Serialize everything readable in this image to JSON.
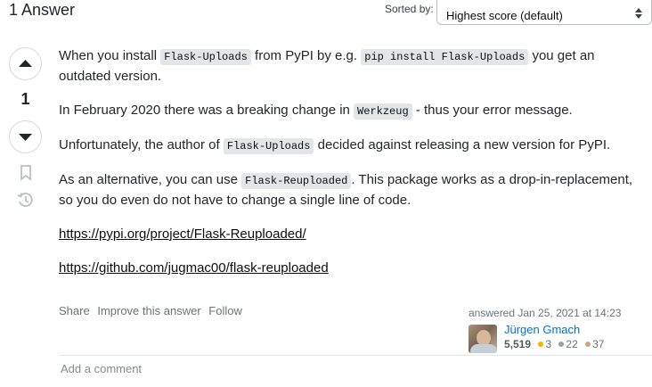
{
  "header": {
    "answers_count": "1 Answer",
    "sort_label": "Sorted by:",
    "sort_value": "Highest score (default)"
  },
  "votes": {
    "score": "1"
  },
  "post": {
    "p1_a": "When you install ",
    "p1_code1": "Flask-Uploads",
    "p1_b": " from PyPI by e.g. ",
    "p1_code2": "pip install Flask-Uploads",
    "p1_c": " you get an outdated version.",
    "p2_a": "In February 2020 there was a breaking change in ",
    "p2_code": "Werkzeug",
    "p2_b": " - thus your error message.",
    "p3_a": "Unfortunately, the author of ",
    "p3_code": "Flask-Uploads",
    "p3_b": " decided against releasing a new version for PyPI.",
    "p4_a": "As an alternative, you can use ",
    "p4_code": "Flask-Reuploaded",
    "p4_b": ". This package works as a drop-in-replacement, so you do even do not have to change a single line of code.",
    "link1": "https://pypi.org/project/Flask-Reuploaded/",
    "link2": "https://github.com/jugmac00/flask-reuploaded"
  },
  "post_menu": {
    "share": "Share",
    "improve": "Improve this answer",
    "follow": "Follow"
  },
  "user": {
    "action": "answered Jan 25, 2021 at 14:23",
    "name": "Jürgen Gmach",
    "reputation": "5,519",
    "gold": "3",
    "silver": "22",
    "bronze": "37"
  },
  "comments": {
    "add_label": "Add a comment"
  },
  "colors": {
    "link_blue": "#0074cc",
    "gold_badge": "#f1b600",
    "silver_badge": "#9a9fa4",
    "bronze_badge": "#d1a684"
  }
}
